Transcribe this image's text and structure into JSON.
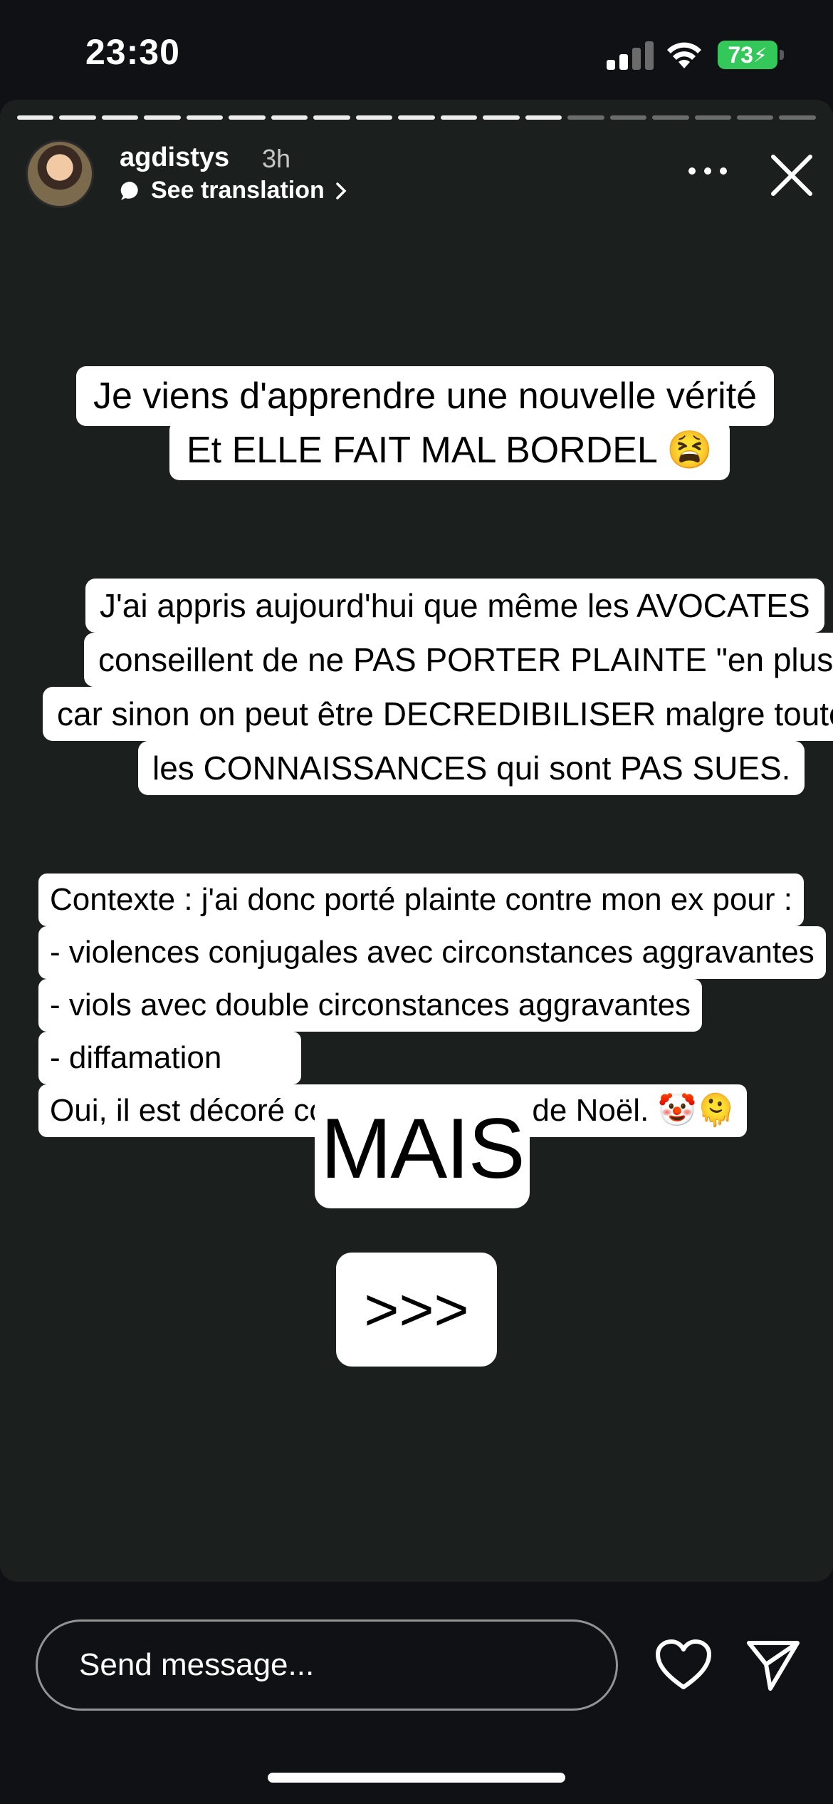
{
  "status_bar": {
    "time": "23:30",
    "battery": "73"
  },
  "story": {
    "segments_total": 19,
    "segments_viewed": 13,
    "username": "agdistys",
    "posted": "3h",
    "translate_label": "See translation",
    "headline": [
      "Je viens d'apprendre une nouvelle vérité",
      "Et ELLE FAIT MAL BORDEL 😫"
    ],
    "paragraph": [
      "J'ai appris aujourd'hui que même les AVOCATES",
      "conseillent de ne PAS PORTER PLAINTE \"en plus\"",
      "car sinon on peut être DECREDIBILISER malgre toutes",
      "les CONNAISSANCES qui sont PAS SUES."
    ],
    "context": [
      "Contexte : j'ai donc porté plainte contre mon ex pour :",
      "- violences conjugales avec circonstances aggravantes",
      "- viols avec double circonstances aggravantes",
      "- diffamation",
      "Oui, il est décoré comme un sapin de Noël. 🤡🫠"
    ],
    "mais": "MAIS",
    "arrows": ">>>"
  },
  "footer": {
    "message_placeholder": "Send message..."
  }
}
